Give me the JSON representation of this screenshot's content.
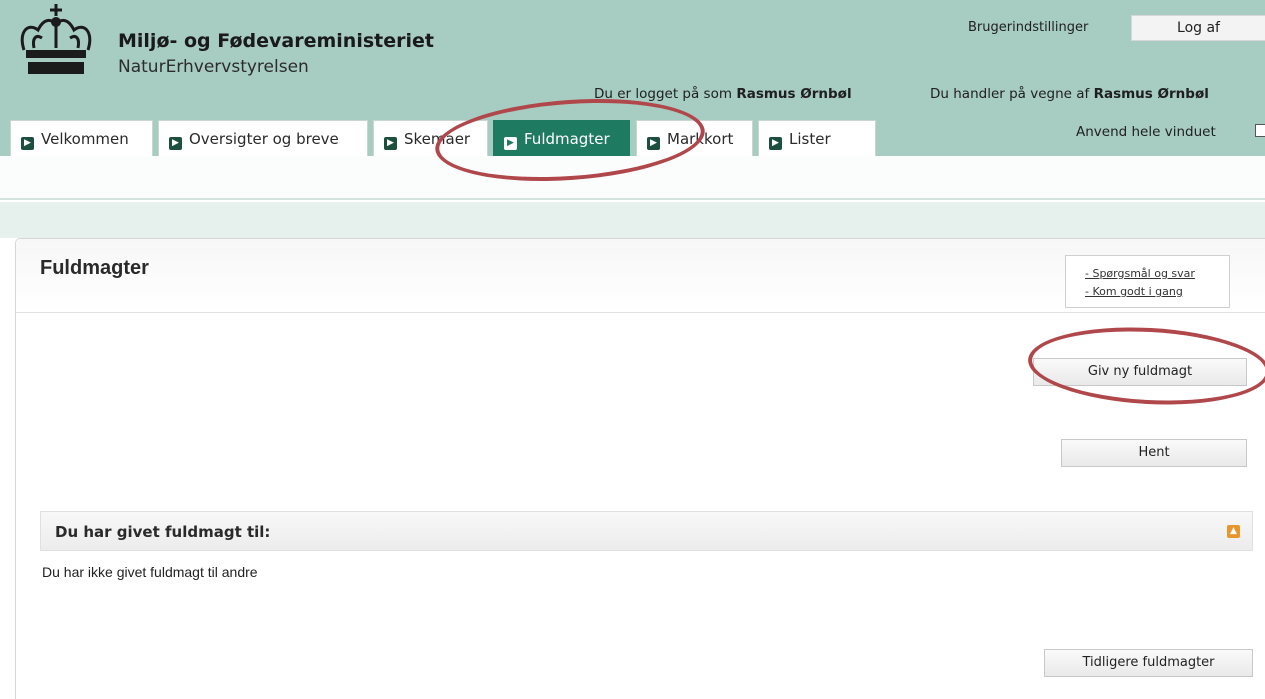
{
  "header": {
    "ministry": "Miljø- og Fødevareministeriet",
    "agency": "NaturErhvervstyrelsen",
    "user_settings": "Brugerindstillinger",
    "logout": "Log af",
    "logged_in_prefix": "Du er logget på som",
    "logged_in_name": "Rasmus Ørnbøl",
    "acting_prefix": "Du handler på vegne af",
    "acting_name": "Rasmus Ørnbøl",
    "fullscreen_label": "Anvend hele vinduet"
  },
  "tabs": [
    {
      "label": "Velkommen"
    },
    {
      "label": "Oversigter og breve"
    },
    {
      "label": "Skemaer"
    },
    {
      "label": "Fuldmagter",
      "active": true
    },
    {
      "label": "Markkort"
    },
    {
      "label": "Lister"
    }
  ],
  "main": {
    "title": "Fuldmagter",
    "help_links": [
      "- Spørgsmål og svar",
      "- Kom godt i gang"
    ],
    "new_button": "Giv ny fuldmagt",
    "fetch_button": "Hent",
    "section_title": "Du har givet fuldmagt til:",
    "empty_text": "Du har ikke givet fuldmagt til andre",
    "previous_button": "Tidligere fuldmagter"
  },
  "colors": {
    "header_bg": "#a7ccc1",
    "active_tab": "#1f7a62",
    "annotation": "#b0474b",
    "collapse_icon": "#e8962b"
  },
  "icons": {
    "logo": "crown-icon",
    "tab": "arrow-right-icon",
    "collapse": "chevron-up-icon"
  }
}
